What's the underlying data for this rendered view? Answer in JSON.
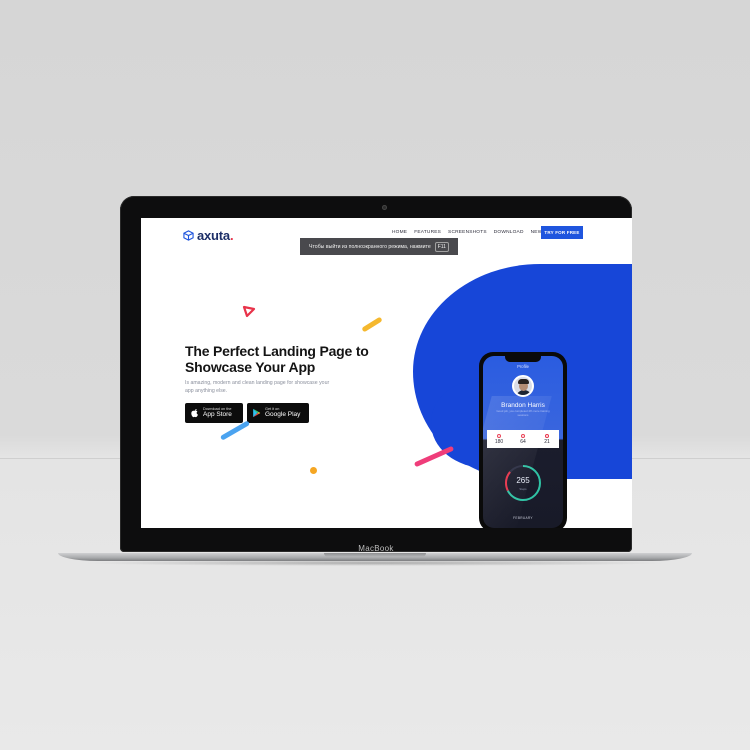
{
  "device": {
    "brand_label": "MacBook"
  },
  "page": {
    "logo": {
      "text": "axuta",
      "dot": ".",
      "icon": "cube-icon"
    },
    "nav": [
      "HOME",
      "FEATURES",
      "SCREENSHOTS",
      "DOWNLOAD",
      "NEWS"
    ],
    "cta_label": "TRY FOR FREE",
    "fullscreen_notice": {
      "text": "Чтобы выйти из полноэкранного режима, нажмите",
      "key": "F11"
    },
    "hero": {
      "title": "The Perfect Landing Page to Showcase Your App",
      "subtitle": "Is amazing, modern and clean landing page for showcase your app anything else."
    },
    "store_buttons": {
      "apple": {
        "small": "Download on the",
        "big": "App Store",
        "icon": "apple-icon"
      },
      "google": {
        "small": "Get it on",
        "big": "Google Play",
        "icon": "play-store-icon"
      }
    },
    "phone": {
      "title": "Profile",
      "name": "Brandon Harris",
      "description": "Good job, you completed 4% more training sessions",
      "stats": [
        "180",
        "64",
        "21"
      ],
      "ring_value": "265",
      "ring_label": "Steps",
      "month": "FEBRUARY"
    },
    "colors": {
      "accent": "#1f55de",
      "blob": "#1746d8",
      "pink": "#e8334a",
      "yellow": "#f5b82e",
      "light_blue": "#4aa3f0",
      "magenta": "#ef3d7a"
    }
  }
}
